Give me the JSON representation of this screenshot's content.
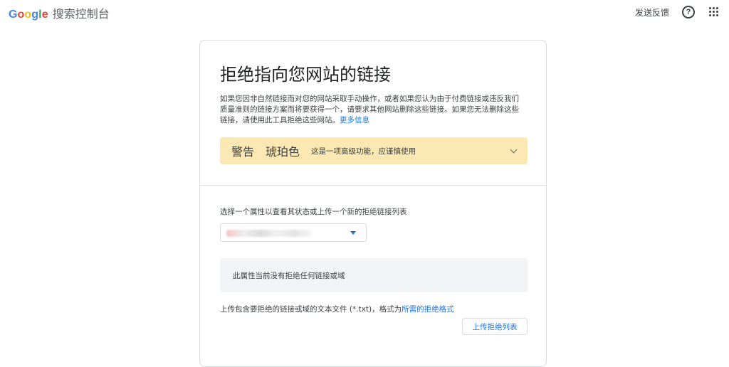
{
  "header": {
    "logo_letters": [
      {
        "char": "G",
        "color": "#4285F4"
      },
      {
        "char": "o",
        "color": "#EA4335"
      },
      {
        "char": "o",
        "color": "#FBBC05"
      },
      {
        "char": "g",
        "color": "#4285F4"
      },
      {
        "char": "l",
        "color": "#34A853"
      },
      {
        "char": "e",
        "color": "#EA4335"
      }
    ],
    "product_name": "搜索控制台",
    "feedback_label": "发送反馈",
    "help_icon": "help-circle-icon",
    "apps_icon": "apps-grid-icon"
  },
  "card": {
    "title": "拒绝指向您网站的链接",
    "intro_text": "如果您因非自然链接而对您的网站采取手动操作，或者如果您认为由于付费链接或违反我们质量准则的链接方案而将要获得一个，请要求其他网站删除这些链接。如果您无法删除这些链接，请使用此工具拒绝这些网站。",
    "intro_link": "更多信息",
    "warning": {
      "title": "警告",
      "level": "琥珀色",
      "description": "这是一项高级功能，应谨慎使用",
      "background": "#fce8b2"
    },
    "select_label": "选择一个属性以查看其状态或上传一个新的拒绝链接列表",
    "empty_message": "此属性当前没有拒绝任何链接或域",
    "upload_text": "上传包含要拒绝的链接或域的文本文件 (*.txt)，格式为",
    "upload_format_link": "所需的拒绝格式",
    "upload_button": "上传拒绝列表"
  },
  "colors": {
    "accent": "#1a73e8",
    "text": "#3c4043",
    "title": "#202124",
    "empty_box_bg": "#f1f3f4"
  }
}
